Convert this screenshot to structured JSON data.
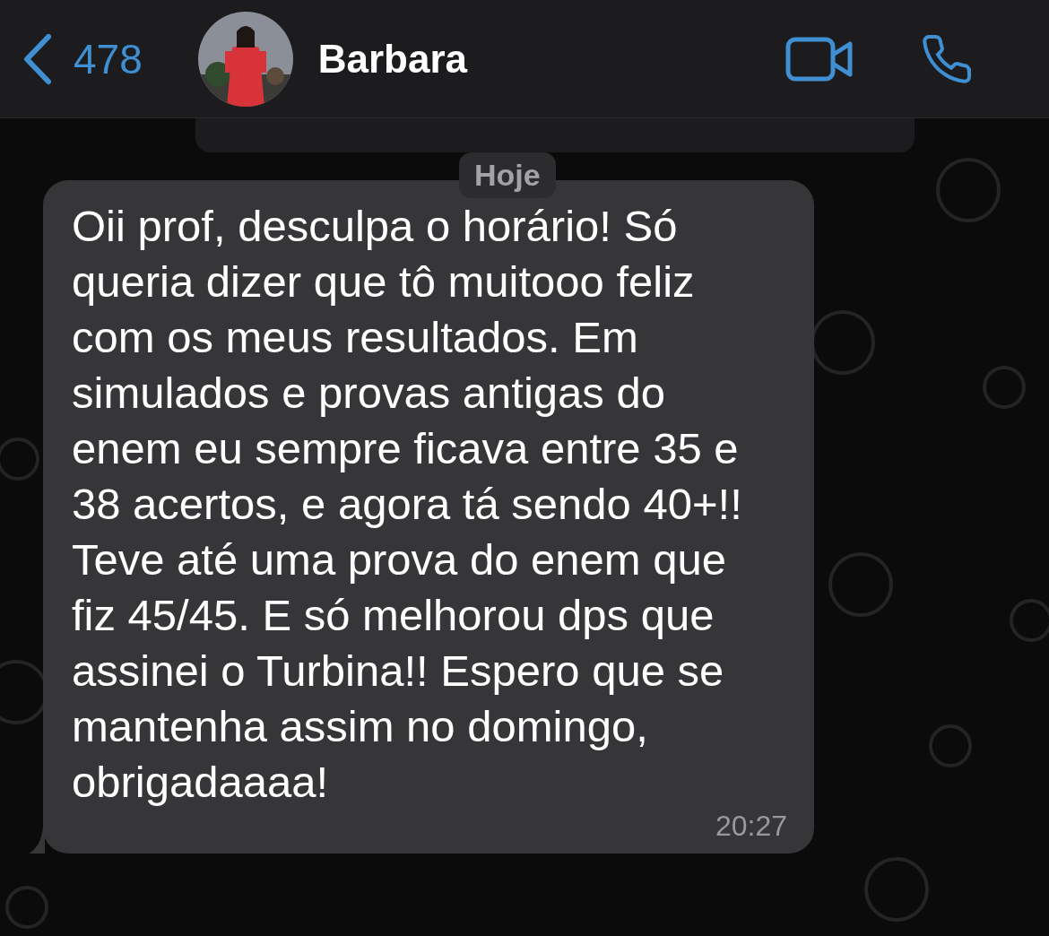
{
  "header": {
    "back_count": "478",
    "contact_name": "Barbara"
  },
  "date_chip": "Hoje",
  "message": {
    "text": "Oii prof, desculpa o horário! Só queria dizer que tô muitooo feliz com os meus resultados. Em simulados e provas antigas do enem eu sempre ficava entre 35 e 38 acertos, e agora tá sendo 40+!! Teve até uma prova do enem que fiz 45/45. E só melhorou dps que assinei o Turbina!! Espero que se mantenha assim no domingo, obrigadaaaa!",
    "time": "20:27"
  }
}
